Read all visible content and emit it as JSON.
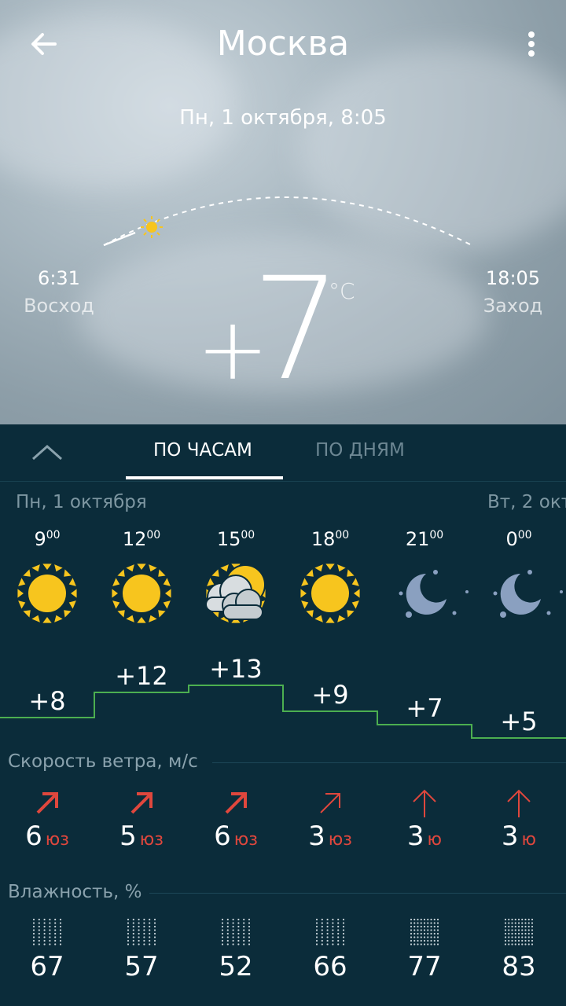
{
  "header": {
    "city": "Москва",
    "datetime": "Пн, 1 октября, 8:05"
  },
  "sun": {
    "sunrise_time": "6:31",
    "sunrise_label": "Восход",
    "sunset_time": "18:05",
    "sunset_label": "Заход"
  },
  "current": {
    "sign": "+",
    "value": "7",
    "unit": "°C"
  },
  "tabs": {
    "hourly": "ПО ЧАСАМ",
    "daily": "ПО ДНЯМ"
  },
  "days": {
    "today": "Пн, 1 октября",
    "tomorrow": "Вт, 2 окт"
  },
  "hours": [
    {
      "h": "9",
      "m": "00",
      "icon": "sun-icon",
      "temp": "+8",
      "wind": "6",
      "wdir": "юз",
      "humidity": "67"
    },
    {
      "h": "12",
      "m": "00",
      "icon": "sun-icon",
      "temp": "+12",
      "wind": "5",
      "wdir": "юз",
      "humidity": "57"
    },
    {
      "h": "15",
      "m": "00",
      "icon": "partly-cloudy-icon",
      "temp": "+13",
      "wind": "6",
      "wdir": "юз",
      "humidity": "52"
    },
    {
      "h": "18",
      "m": "00",
      "icon": "sun-icon",
      "temp": "+9",
      "wind": "3",
      "wdir": "юз",
      "humidity": "66"
    },
    {
      "h": "21",
      "m": "00",
      "icon": "moon-icon",
      "temp": "+7",
      "wind": "3",
      "wdir": "ю",
      "humidity": "77"
    },
    {
      "h": "0",
      "m": "00",
      "icon": "moon-icon",
      "temp": "+5",
      "wind": "3",
      "wdir": "ю",
      "humidity": "83"
    }
  ],
  "sections": {
    "wind": "Скорость ветра, м/с",
    "humidity": "Влажность, %"
  },
  "colors": {
    "accent_line": "#4caf50",
    "wind_dir": "#e0473d",
    "sun": "#f7c51e",
    "panel": "#0b2c3a"
  }
}
